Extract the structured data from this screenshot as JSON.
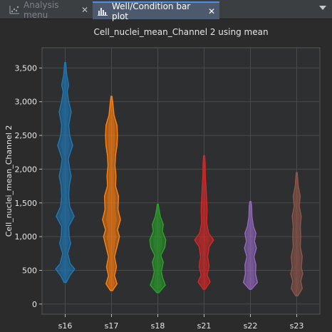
{
  "tabs": [
    {
      "label": "Analysis menu",
      "close": "✕",
      "icon": "scatter-icon"
    },
    {
      "label": "Well/Condition bar plot",
      "close": "✕",
      "icon": "bar-chart-icon"
    }
  ],
  "colors": {
    "background": "#2b2b2b",
    "grid": "#4a4a4a",
    "series": [
      "#1f77b4",
      "#ff7f0e",
      "#2ca02c",
      "#d62728",
      "#9467bd",
      "#8c564b"
    ]
  },
  "chart_data": {
    "type": "violin",
    "title": "Cell_nuclei_mean_Channel 2 using mean",
    "xlabel": "",
    "ylabel": "Cell_nuclei_mean_Channel 2",
    "categories": [
      "s16",
      "s17",
      "s18",
      "s21",
      "s22",
      "s23"
    ],
    "ylim": [
      -150,
      3800
    ],
    "yticks": [
      0,
      500,
      1000,
      1500,
      2000,
      2500,
      3000,
      3500
    ],
    "ytick_labels": [
      "0",
      "500",
      "1,000",
      "1,500",
      "2,000",
      "2,500",
      "3,000",
      "3,500"
    ],
    "grid": true,
    "series": [
      {
        "category": "s16",
        "min": 320,
        "max": 3580,
        "profile": [
          [
            320,
            0.1
          ],
          [
            420,
            0.45
          ],
          [
            520,
            0.95
          ],
          [
            600,
            0.5
          ],
          [
            750,
            0.25
          ],
          [
            900,
            0.55
          ],
          [
            1000,
            0.4
          ],
          [
            1150,
            0.35
          ],
          [
            1300,
            0.9
          ],
          [
            1450,
            0.45
          ],
          [
            1600,
            0.35
          ],
          [
            1750,
            0.4
          ],
          [
            1900,
            0.6
          ],
          [
            2000,
            0.45
          ],
          [
            2150,
            0.3
          ],
          [
            2350,
            0.75
          ],
          [
            2500,
            0.45
          ],
          [
            2650,
            0.35
          ],
          [
            2850,
            0.6
          ],
          [
            3000,
            0.35
          ],
          [
            3150,
            0.2
          ],
          [
            3250,
            0.35
          ],
          [
            3400,
            0.15
          ],
          [
            3580,
            0.05
          ]
        ]
      },
      {
        "category": "s17",
        "min": 200,
        "max": 3080,
        "profile": [
          [
            200,
            0.1
          ],
          [
            300,
            0.55
          ],
          [
            420,
            0.3
          ],
          [
            550,
            0.5
          ],
          [
            700,
            0.3
          ],
          [
            850,
            0.55
          ],
          [
            1000,
            0.8
          ],
          [
            1100,
            0.6
          ],
          [
            1250,
            0.9
          ],
          [
            1400,
            0.65
          ],
          [
            1600,
            0.7
          ],
          [
            1750,
            0.4
          ],
          [
            1900,
            0.45
          ],
          [
            2050,
            0.35
          ],
          [
            2200,
            0.4
          ],
          [
            2350,
            0.55
          ],
          [
            2500,
            0.6
          ],
          [
            2650,
            0.55
          ],
          [
            2800,
            0.25
          ],
          [
            2950,
            0.15
          ],
          [
            3080,
            0.05
          ]
        ]
      },
      {
        "category": "s18",
        "min": 170,
        "max": 1480,
        "profile": [
          [
            170,
            0.1
          ],
          [
            280,
            0.75
          ],
          [
            380,
            0.5
          ],
          [
            480,
            0.35
          ],
          [
            620,
            0.55
          ],
          [
            720,
            0.3
          ],
          [
            840,
            0.7
          ],
          [
            950,
            0.8
          ],
          [
            1080,
            0.45
          ],
          [
            1180,
            0.55
          ],
          [
            1300,
            0.25
          ],
          [
            1400,
            0.12
          ],
          [
            1480,
            0.05
          ]
        ]
      },
      {
        "category": "s21",
        "min": 220,
        "max": 2200,
        "profile": [
          [
            220,
            0.1
          ],
          [
            330,
            0.6
          ],
          [
            430,
            0.3
          ],
          [
            560,
            0.5
          ],
          [
            700,
            0.35
          ],
          [
            850,
            0.5
          ],
          [
            950,
            0.95
          ],
          [
            1050,
            0.45
          ],
          [
            1200,
            0.25
          ],
          [
            1400,
            0.3
          ],
          [
            1550,
            0.25
          ],
          [
            1700,
            0.2
          ],
          [
            1900,
            0.12
          ],
          [
            2100,
            0.1
          ],
          [
            2200,
            0.05
          ]
        ]
      },
      {
        "category": "s22",
        "min": 220,
        "max": 1520,
        "profile": [
          [
            220,
            0.1
          ],
          [
            320,
            0.7
          ],
          [
            450,
            0.5
          ],
          [
            580,
            0.55
          ],
          [
            700,
            0.35
          ],
          [
            830,
            0.6
          ],
          [
            930,
            0.4
          ],
          [
            1050,
            0.55
          ],
          [
            1150,
            0.3
          ],
          [
            1300,
            0.15
          ],
          [
            1450,
            0.12
          ],
          [
            1520,
            0.05
          ]
        ]
      },
      {
        "category": "s23",
        "min": 120,
        "max": 1950,
        "profile": [
          [
            120,
            0.1
          ],
          [
            230,
            0.55
          ],
          [
            340,
            0.4
          ],
          [
            450,
            0.6
          ],
          [
            550,
            0.45
          ],
          [
            700,
            0.55
          ],
          [
            850,
            0.35
          ],
          [
            1000,
            0.4
          ],
          [
            1150,
            0.35
          ],
          [
            1300,
            0.45
          ],
          [
            1450,
            0.25
          ],
          [
            1600,
            0.35
          ],
          [
            1750,
            0.15
          ],
          [
            1850,
            0.1
          ],
          [
            1950,
            0.05
          ]
        ]
      }
    ]
  }
}
